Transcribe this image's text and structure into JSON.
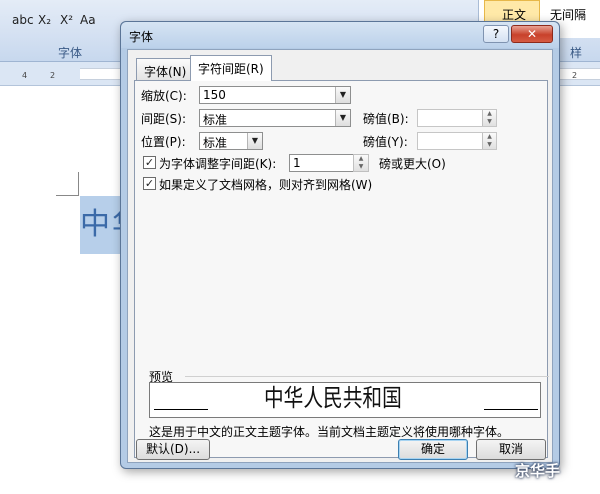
{
  "ribbon": {
    "format_buttons": [
      "abc",
      "X₂",
      "X²",
      "Aa"
    ],
    "group_font": "字体",
    "group_styles": "样",
    "style_normal": "正文",
    "style_no_spacing": "无间隔",
    "ruler_numbers": [
      "4",
      "2",
      "2",
      "4",
      "6"
    ]
  },
  "document": {
    "text": "中华"
  },
  "dialog": {
    "title": "字体",
    "help": "?",
    "close": "✕",
    "tabs": {
      "font": "字体(N)",
      "spacing": "字符间距(R)"
    },
    "scale_label": "缩放(C):",
    "scale_value": "150",
    "spacing_label": "间距(S):",
    "spacing_value": "标准",
    "spacing_by_label": "磅值(B):",
    "position_label": "位置(P):",
    "position_value": "标准",
    "position_by_label": "磅值(Y):",
    "kerning_label": "为字体调整字间距(K):",
    "kerning_value": "1",
    "kerning_suffix": "磅或更大(O)",
    "kerning_checked": "✓",
    "grid_label": "如果定义了文档网格，则对齐到网格(W)",
    "grid_checked": "✓",
    "preview_label": "预览",
    "preview_text": "中华人民共和国",
    "preview_desc": "这是用于中文的正文主题字体。当前文档主题定义将使用哪种字体。",
    "default_button": "默认(D)...",
    "ok_button": "确定",
    "cancel_button": "取消"
  },
  "watermark": "京华手"
}
